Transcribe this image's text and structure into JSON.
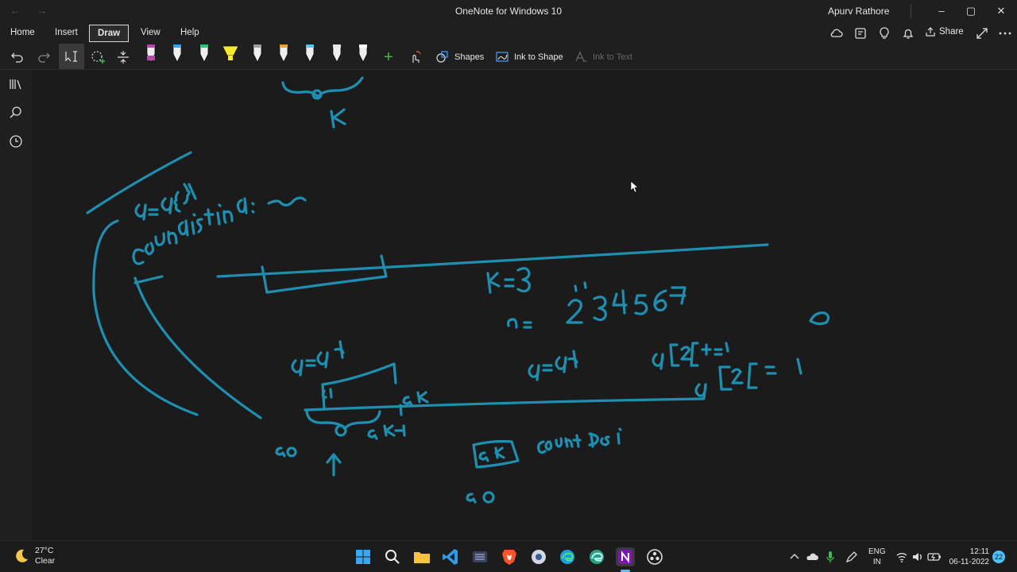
{
  "app": {
    "title": "OneNote for Windows 10",
    "user": "Apurv Rathore",
    "window_controls": {
      "minimize": "–",
      "maximize": "▢",
      "close": "✕"
    }
  },
  "ribbon": {
    "tabs": [
      {
        "label": "Home",
        "active": false
      },
      {
        "label": "Insert",
        "active": false
      },
      {
        "label": "Draw",
        "active": true
      },
      {
        "label": "View",
        "active": false
      },
      {
        "label": "Help",
        "active": false
      }
    ],
    "share_label": "Share"
  },
  "toolbar": {
    "shapes_label": "Shapes",
    "ink_to_shape_label": "Ink to Shape",
    "ink_to_text_label": "Ink to Text",
    "add_pen": "+"
  },
  "pens": [
    {
      "name": "eraser-pen",
      "color": "#b24aa8"
    },
    {
      "name": "blue-pen",
      "color": "#3aa0e8"
    },
    {
      "name": "green-pen",
      "color": "#2ec27a"
    },
    {
      "name": "yellow-highlighter",
      "color": "#f5ea2e"
    },
    {
      "name": "gray-pen",
      "color": "#9aa0a6"
    },
    {
      "name": "rainbow-pen",
      "color": "#e8a23a"
    },
    {
      "name": "cyan-pen",
      "color": "#58c6e8"
    },
    {
      "name": "white-pen",
      "color": "#e6e6e6"
    },
    {
      "name": "white-pen-2",
      "color": "#ffffff"
    }
  ],
  "ink_color": "#1e8fb0",
  "taskbar": {
    "weather_temp": "27°C",
    "weather_desc": "Clear",
    "lang_line1": "ENG",
    "lang_line2": "IN",
    "time": "12:11",
    "date": "06-11-2022",
    "notification_count": "22"
  }
}
